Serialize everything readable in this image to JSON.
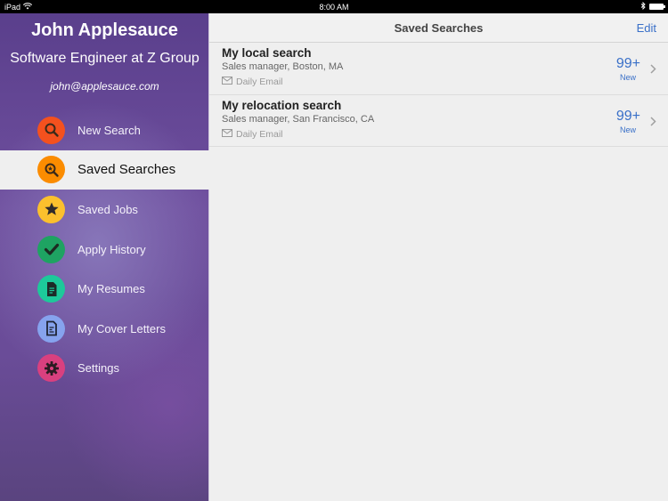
{
  "status_bar": {
    "device": "iPad",
    "time": "8:00 AM"
  },
  "sidebar": {
    "profile": {
      "name": "John Applesauce",
      "title": "Software Engineer at Z Group",
      "email": "john@applesauce.com"
    },
    "items": [
      {
        "label": "New Search",
        "icon": "search-icon",
        "color": "#f4511e",
        "active": false
      },
      {
        "label": "Saved Searches",
        "icon": "saved-search-icon",
        "color": "#fb8c00",
        "active": true
      },
      {
        "label": "Saved Jobs",
        "icon": "star-icon",
        "color": "#fbc02d",
        "active": false
      },
      {
        "label": "Apply History",
        "icon": "checkmark-icon",
        "color": "#1ea362",
        "active": false
      },
      {
        "label": "My Resumes",
        "icon": "document-icon",
        "color": "#1dc99a",
        "active": false
      },
      {
        "label": "My Cover Letters",
        "icon": "cover-letter-icon",
        "color": "#86a3ee",
        "active": false
      },
      {
        "label": "Settings",
        "icon": "gear-icon",
        "color": "#d9407f",
        "active": false
      }
    ]
  },
  "main": {
    "title": "Saved Searches",
    "edit_label": "Edit",
    "searches": [
      {
        "name": "My local search",
        "criteria": "Sales manager, Boston, MA",
        "frequency": "Daily Email",
        "count": "99+",
        "count_label": "New"
      },
      {
        "name": "My relocation search",
        "criteria": "Sales manager, San Francisco, CA",
        "frequency": "Daily Email",
        "count": "99+",
        "count_label": "New"
      }
    ]
  },
  "colors": {
    "accent": "#3a70c8",
    "sidebar_purple": "#6a4c98"
  }
}
